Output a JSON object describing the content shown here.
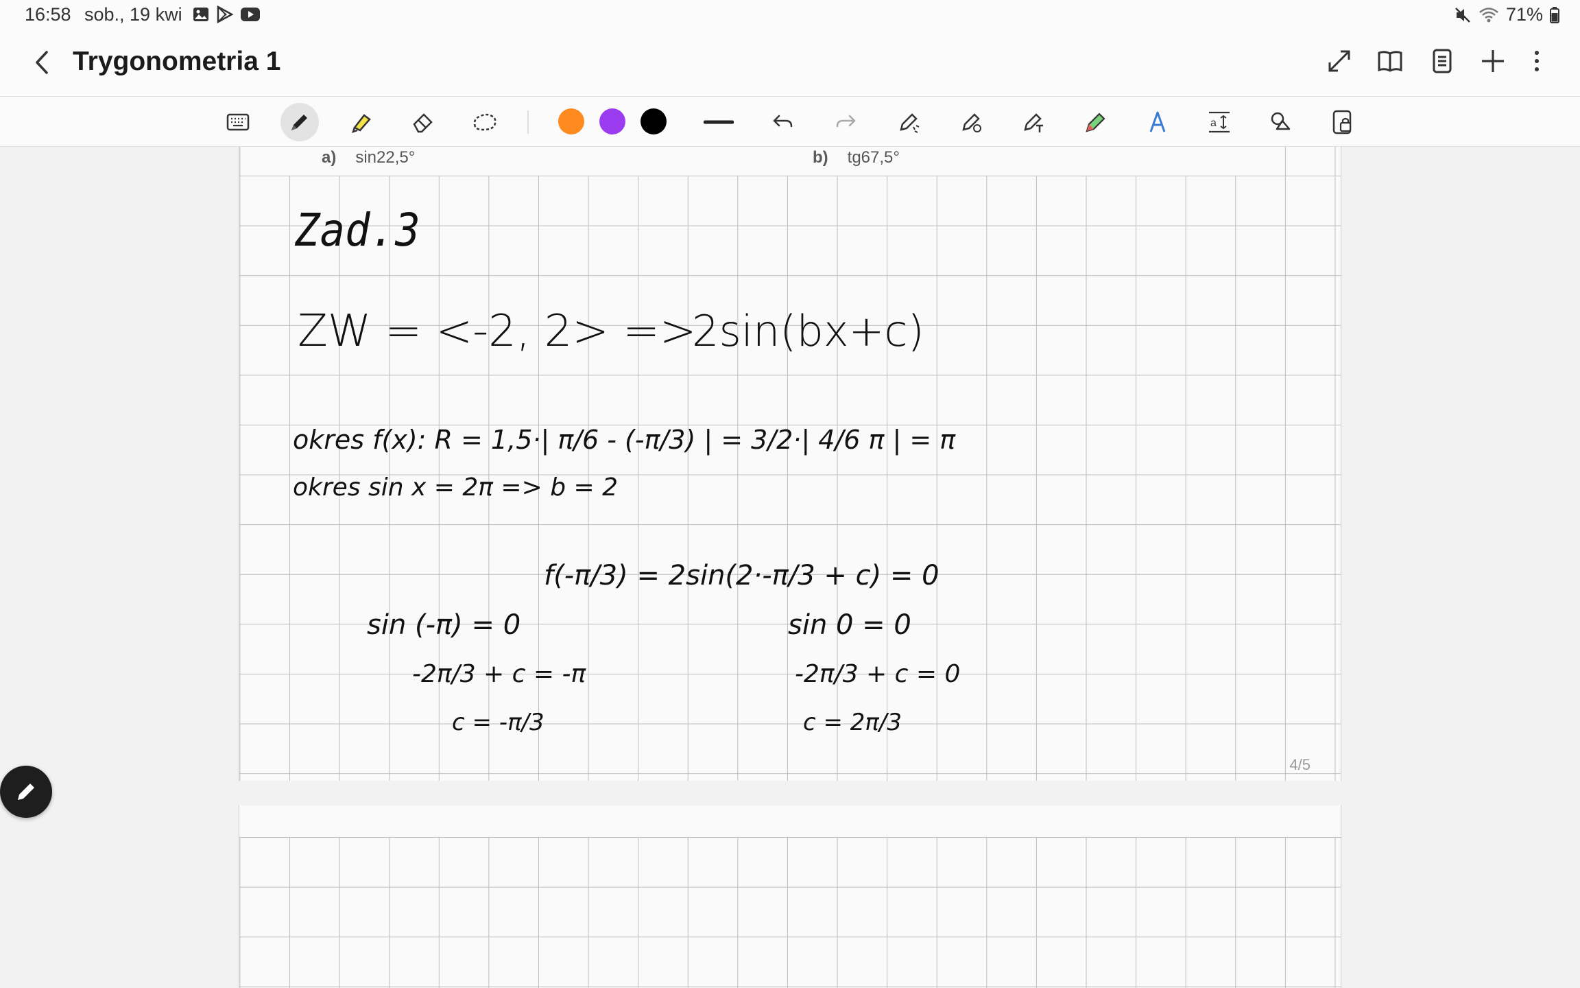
{
  "status_bar": {
    "time": "16:58",
    "date": "sob., 19 kwi",
    "battery": "71%",
    "notification_icons": [
      "gallery-icon",
      "play-store-icon",
      "youtube-icon"
    ]
  },
  "header": {
    "title": "Trygonometria 1"
  },
  "toolbar": {
    "colors": [
      "#ff8a1f",
      "#9b3cf0",
      "#000000"
    ]
  },
  "page": {
    "task_a_label": "a)",
    "task_a_value": "sin22,5°",
    "task_b_label": "b)",
    "task_b_value": "tg67,5°",
    "page_number": "4/5"
  },
  "handwriting": {
    "heading": "Zad.3",
    "line1_left": "ZW = <-2, 2> =>",
    "line1_right": "2sin(bx+c)",
    "line2": "okres f(x): R = 1,5·| π/6 - (-π/3) | = 3/2·| 4/6 π | = π",
    "line3": "okres sin x = 2π => b = 2",
    "line4": "f(-π/3) = 2sin(2·-π/3 + c) = 0",
    "left_col": [
      "sin (-π) = 0",
      "-2π/3 + c = -π",
      "c = -π/3"
    ],
    "right_col": [
      "sin 0 = 0",
      "-2π/3 + c = 0",
      "c = 2π/3"
    ]
  }
}
